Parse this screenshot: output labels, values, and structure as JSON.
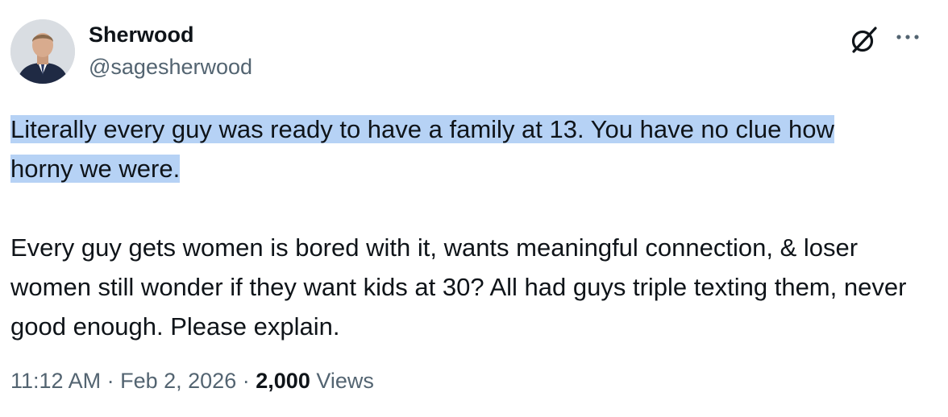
{
  "author": {
    "display_name": "Sherwood",
    "handle": "@sagesherwood",
    "avatar_icon": "profile-photo"
  },
  "actions": {
    "grok_icon": "grok-icon",
    "more_icon": "more-icon"
  },
  "tweet": {
    "paragraph1_line1": "Literally every guy was ready to have a family at 13. You have no clue how",
    "paragraph1_line2": "horny we were.",
    "paragraph2": "Every guy gets women is bored with it, wants meaningful connection, & loser women still wonder if they want kids at 30? All had guys triple texting them, never good enough. Please explain.",
    "selection_color": "#b6d2f5"
  },
  "meta": {
    "time": "11:12 AM",
    "separator": "·",
    "date": "Feb 2, 2026",
    "views_count": "2,000",
    "views_label": "Views"
  }
}
